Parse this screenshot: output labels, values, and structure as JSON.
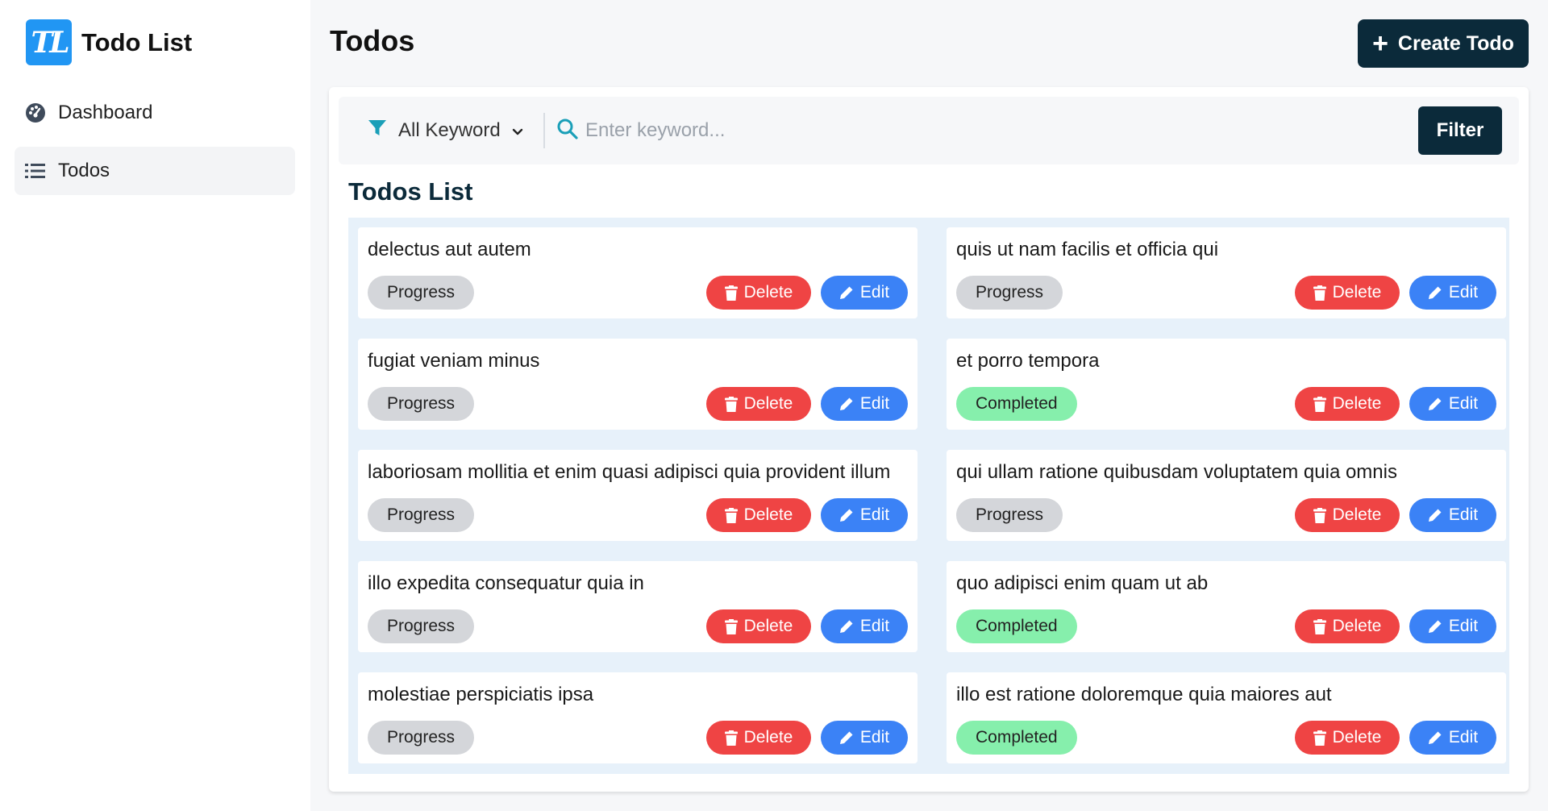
{
  "brand": {
    "logo_text": "TL",
    "name": "Todo List"
  },
  "sidebar": {
    "items": [
      {
        "label": "Dashboard",
        "icon": "dashboard-icon",
        "active": false
      },
      {
        "label": "Todos",
        "icon": "list-icon",
        "active": true
      }
    ]
  },
  "header": {
    "title": "Todos",
    "create_label": "Create Todo"
  },
  "filter": {
    "keyword_select": "All Keyword",
    "search_placeholder": "Enter keyword...",
    "search_value": "",
    "button_label": "Filter"
  },
  "list": {
    "title": "Todos List",
    "delete_label": "Delete",
    "edit_label": "Edit",
    "items": [
      {
        "title": "delectus aut autem",
        "status": "Progress"
      },
      {
        "title": "quis ut nam facilis et officia qui",
        "status": "Progress"
      },
      {
        "title": "fugiat veniam minus",
        "status": "Progress"
      },
      {
        "title": "et porro tempora",
        "status": "Completed"
      },
      {
        "title": "laboriosam mollitia et enim quasi adipisci quia provident illum",
        "status": "Progress"
      },
      {
        "title": "qui ullam ratione quibusdam voluptatem quia omnis",
        "status": "Progress"
      },
      {
        "title": "illo expedita consequatur quia in",
        "status": "Progress"
      },
      {
        "title": "quo adipisci enim quam ut ab",
        "status": "Completed"
      },
      {
        "title": "molestiae perspiciatis ipsa",
        "status": "Progress"
      },
      {
        "title": "illo est ratione doloremque quia maiores aut",
        "status": "Completed"
      }
    ]
  },
  "colors": {
    "primary_dark": "#0b2a3a",
    "brand_blue": "#2196f3",
    "delete_red": "#ef4444",
    "edit_blue": "#3b82f6",
    "progress_gray": "#d4d6da",
    "completed_green": "#86efac"
  }
}
